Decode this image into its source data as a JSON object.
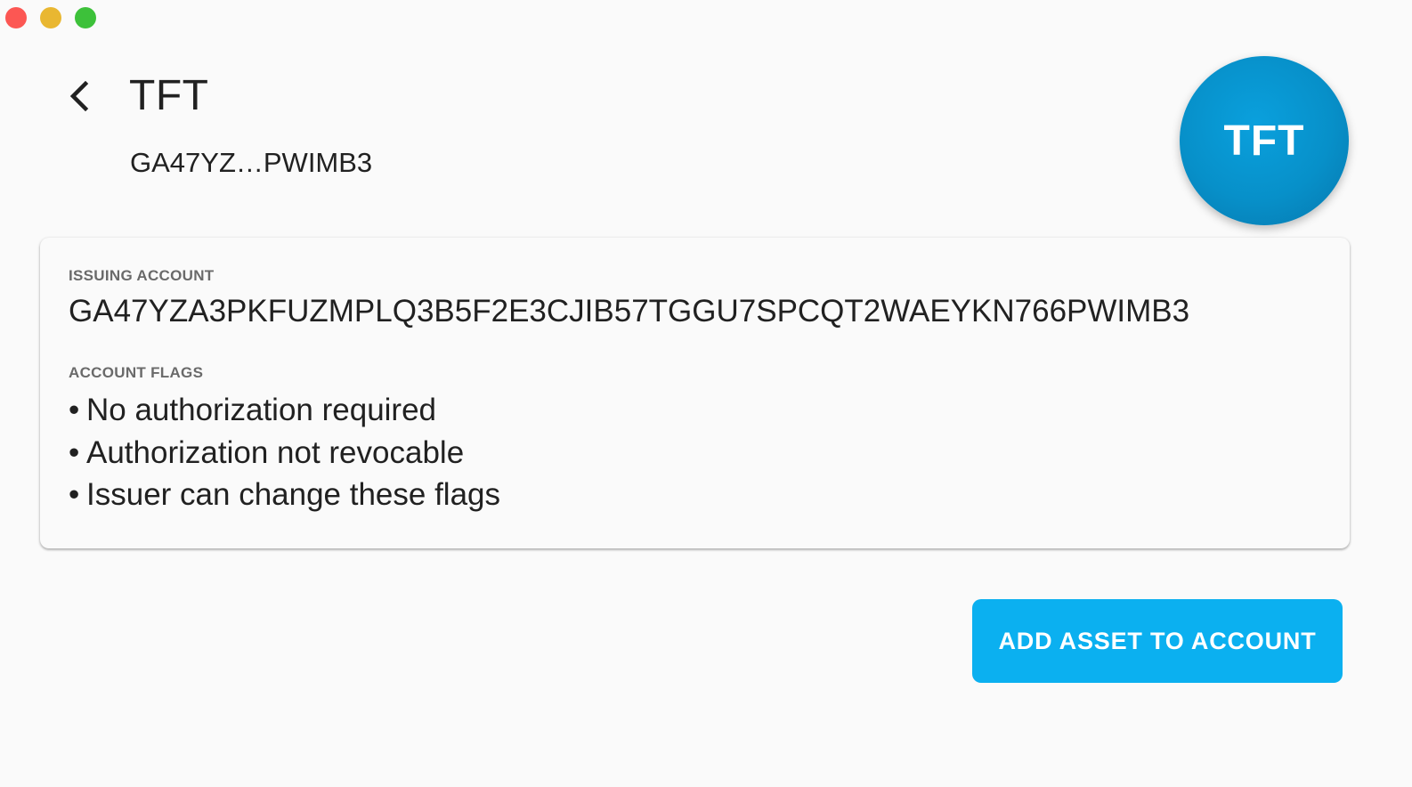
{
  "window": {
    "controls": [
      "close",
      "minimize",
      "maximize"
    ]
  },
  "header": {
    "back_icon": "chevron-left-icon",
    "title": "TFT",
    "subtitle": "GA47YZ…PWIMB3",
    "logo_text": "TFT",
    "logo_color": "#0790c9"
  },
  "card": {
    "issuing_label": "ISSUING ACCOUNT",
    "issuing_value": "GA47YZA3PKFUZMPLQ3B5F2E3CJIB57TGGU7SPCQT2WAEYKN766PWIMB3",
    "flags_label": "ACCOUNT FLAGS",
    "flags": [
      "No authorization required",
      "Authorization not revocable",
      "Issuer can change these flags"
    ]
  },
  "actions": {
    "add_asset_label": "ADD ASSET TO ACCOUNT",
    "add_asset_color": "#0bb0f0"
  }
}
